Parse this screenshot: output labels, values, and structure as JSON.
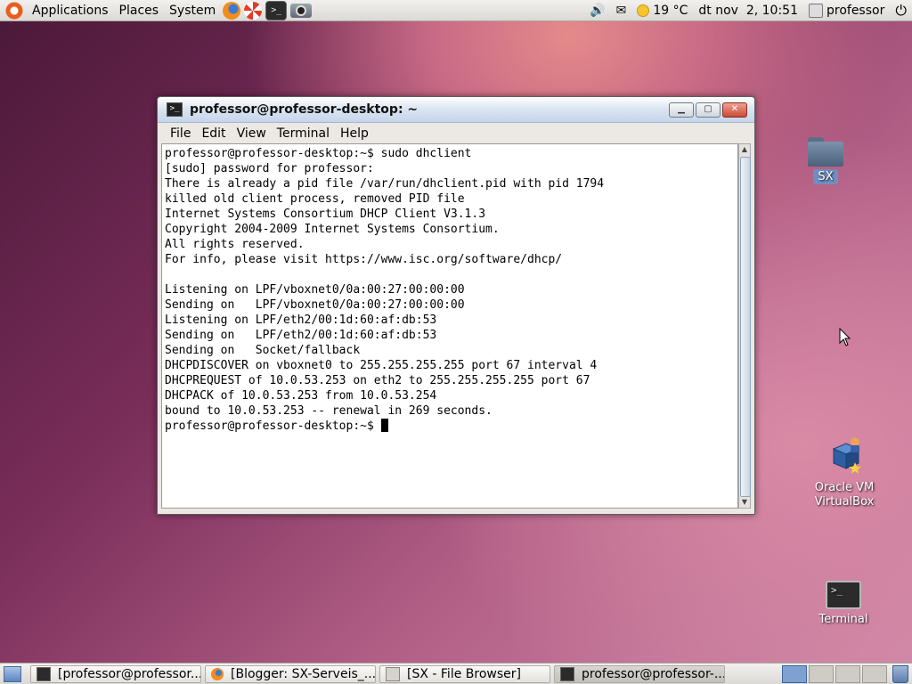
{
  "top_panel": {
    "menus": [
      "Applications",
      "Places",
      "System"
    ],
    "launchers": [
      "firefox-icon",
      "help-lifebuoy-icon",
      "terminal-icon",
      "screenshot-camera-icon"
    ],
    "weather": "19 °C",
    "datetime": "dt nov  2, 10:51",
    "user": "professor"
  },
  "desktop_icons": [
    {
      "label": "SX",
      "icon": "folder-icon"
    },
    {
      "label": "Oracle VM VirtualBox",
      "icon": "virtualbox-icon"
    },
    {
      "label": "Terminal",
      "icon": "terminal-icon"
    }
  ],
  "terminal_window": {
    "title": "professor@professor-desktop: ~",
    "menu": [
      "File",
      "Edit",
      "View",
      "Terminal",
      "Help"
    ],
    "lines": [
      "professor@professor-desktop:~$ sudo dhclient",
      "[sudo] password for professor:",
      "There is already a pid file /var/run/dhclient.pid with pid 1794",
      "killed old client process, removed PID file",
      "Internet Systems Consortium DHCP Client V3.1.3",
      "Copyright 2004-2009 Internet Systems Consortium.",
      "All rights reserved.",
      "For info, please visit https://www.isc.org/software/dhcp/",
      "",
      "Listening on LPF/vboxnet0/0a:00:27:00:00:00",
      "Sending on   LPF/vboxnet0/0a:00:27:00:00:00",
      "Listening on LPF/eth2/00:1d:60:af:db:53",
      "Sending on   LPF/eth2/00:1d:60:af:db:53",
      "Sending on   Socket/fallback",
      "DHCPDISCOVER on vboxnet0 to 255.255.255.255 port 67 interval 4",
      "DHCPREQUEST of 10.0.53.253 on eth2 to 255.255.255.255 port 67",
      "DHCPACK of 10.0.53.253 from 10.0.53.254",
      "bound to 10.0.53.253 -- renewal in 269 seconds."
    ],
    "prompt": "professor@professor-desktop:~$ "
  },
  "taskbar": {
    "tasks": [
      {
        "label": "[professor@professor...",
        "icon": "terminal-icon",
        "active": false
      },
      {
        "label": "[Blogger: SX-Serveis_...",
        "icon": "firefox-icon",
        "active": false
      },
      {
        "label": "[SX - File Browser]",
        "icon": "file-browser-icon",
        "active": false
      },
      {
        "label": "professor@professor-...",
        "icon": "terminal-icon",
        "active": true
      }
    ],
    "workspaces": 4,
    "active_workspace": 1
  }
}
